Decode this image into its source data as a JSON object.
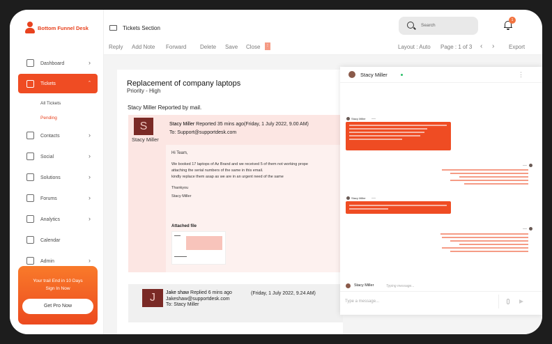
{
  "brand": {
    "name": "Bottom Funnel Desk",
    "accent": "#ef4c23"
  },
  "sidebar": {
    "items": [
      {
        "label": "Dashboard",
        "icon": "dashboard-icon"
      },
      {
        "label": "Tickets",
        "icon": "ticket-icon",
        "active": true
      },
      {
        "label": "Contacts",
        "icon": "contacts-icon"
      },
      {
        "label": "Social",
        "icon": "social-icon"
      },
      {
        "label": "Solutions",
        "icon": "solutions-icon"
      },
      {
        "label": "Forums",
        "icon": "forums-icon"
      },
      {
        "label": "Analytics",
        "icon": "analytics-icon"
      },
      {
        "label": "Calendar",
        "icon": "calendar-icon"
      },
      {
        "label": "Admin",
        "icon": "admin-icon"
      }
    ],
    "sub_items": [
      "All Tickets",
      "Pending"
    ],
    "promo": {
      "line1": "Your trail End in 10 Days",
      "line2": "Sign In Now",
      "button": "Get Pro Now"
    }
  },
  "header": {
    "section_title": "Tickets Section",
    "search_placeholder": "Search",
    "notification_count": "1"
  },
  "toolbar": {
    "reply": "Reply",
    "add_note": "Add Note",
    "forward": "Forward",
    "delete": "Delete",
    "save": "Save",
    "close": "Close",
    "layout": "Layout : Auto",
    "page": "Page : 1 of 3",
    "export": "Export"
  },
  "ticket": {
    "title": "Replacement of company laptops",
    "priority": "Priority  - High",
    "reported_by": "Stacy Miller Reported by mail.",
    "message1": {
      "initial": "S",
      "author": "Stacy Miller",
      "reported": "Reported 35 mins ago",
      "date": "(Friday, 1 July 2022, 9.00 AM)",
      "to": "To: Support@supportdesk.com",
      "body": [
        "Hi Team,",
        "We booked 17 laptops of Az Brand and we received 5 of them not working prope",
        "attaching the serial numbers of the same in this email.",
        "kindly replace them asap as we are in an urgent need of the same",
        "Thankyou",
        "Stacy Miller"
      ],
      "attached_label": "Attached file"
    },
    "message2": {
      "initial": "J",
      "author": "Jake shaw",
      "replied": "Replied 6 mins ago",
      "date": "(Friday, 1 July 2022, 9.24 AM)",
      "email": "Jakeshaw@supportdesk.com",
      "to": "To: Stacy Miller"
    }
  },
  "chat": {
    "contact": "Stacy Miller",
    "typing_label": "Stacy Miller",
    "typing_text": "Typing message...",
    "input_placeholder": "Type a message..."
  }
}
